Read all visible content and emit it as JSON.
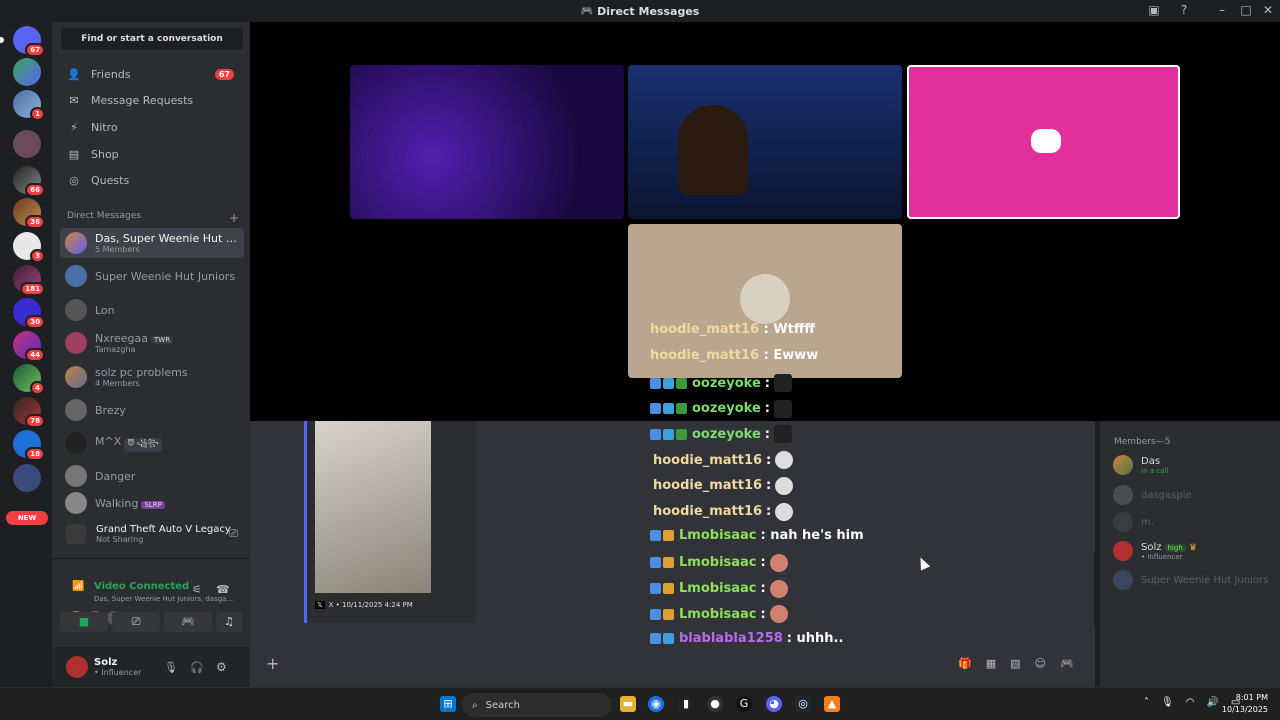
{
  "window": {
    "title": "Direct Messages"
  },
  "servers": {
    "badges": [
      "67",
      "1",
      "66",
      "36",
      "3",
      "181",
      "30",
      "44",
      "4",
      "78",
      "18"
    ],
    "new_label": "NEW"
  },
  "sidebar": {
    "search_placeholder": "Find or start a conversation",
    "nav": [
      {
        "label": "Friends",
        "icon": "friends-icon",
        "count": "67"
      },
      {
        "label": "Message Requests",
        "icon": "mail-icon"
      },
      {
        "label": "Nitro",
        "icon": "nitro-icon"
      },
      {
        "label": "Shop",
        "icon": "shop-icon"
      },
      {
        "label": "Quests",
        "icon": "quests-icon"
      }
    ],
    "dm_header": "Direct Messages",
    "dms": [
      {
        "name": "Das, Super Weenie Hut Juni...",
        "sub": "5 Members",
        "active": true
      },
      {
        "name": "Super Weenie Hut Juniors",
        "sub": ""
      },
      {
        "name": "Lon",
        "sub": ""
      },
      {
        "name": "Nxreegaa",
        "tag": "TWR",
        "sub": "Tamazgha"
      },
      {
        "name": "solz pc problems",
        "sub": "4 Members"
      },
      {
        "name": "Brezy",
        "sub": ""
      },
      {
        "name": "M^X",
        "tag": "😈 ꧁꧂",
        "sub": ""
      },
      {
        "name": "Danger",
        "sub": ""
      },
      {
        "name": "Walking",
        "tag": "SLRP",
        "sub": ""
      }
    ],
    "activity": {
      "game": "Grand Theft Auto V Legacy",
      "status": "Not Sharing"
    },
    "voice": {
      "status": "Video Connected",
      "channel": "Das, Super Weenie Hut Juniors, dasga..."
    },
    "user": {
      "name": "Solz",
      "status": "• Influencer"
    }
  },
  "chat": {
    "overlay_messages": [
      {
        "user": "hoodie_matt16",
        "text": "Wtffff"
      },
      {
        "user": "hoodie_matt16",
        "text": "Ewww"
      }
    ],
    "messages": [
      {
        "user": "oozeyoke",
        "text": ":",
        "kind": "ooze"
      },
      {
        "user": "oozeyoke",
        "text": ":",
        "kind": "ooze"
      },
      {
        "user": "oozeyoke",
        "text": ":",
        "kind": "ooze"
      },
      {
        "user": "hoodie_matt16",
        "text": ":",
        "kind": "hood"
      },
      {
        "user": "hoodie_matt16",
        "text": ":",
        "kind": "hood"
      },
      {
        "user": "hoodie_matt16",
        "text": ":",
        "kind": "hood"
      },
      {
        "user": "Lmobisaac",
        "text": ": nah he's him",
        "kind": "lmo"
      },
      {
        "user": "Lmobisaac",
        "text": ":",
        "kind": "lmo"
      },
      {
        "user": "Lmobisaac",
        "text": ":",
        "kind": "lmo"
      },
      {
        "user": "Lmobisaac",
        "text": ":",
        "kind": "lmo"
      },
      {
        "user": "blablabla1258",
        "text": ": uhhh..",
        "kind": "bla"
      }
    ],
    "embed_footer": "X • 10/11/2025 4:24 PM"
  },
  "members": {
    "header": "Members—5",
    "list": [
      {
        "name": "Das",
        "sub": "In a call",
        "dim": false
      },
      {
        "name": "dasgaspie",
        "sub": "",
        "dim": true
      },
      {
        "name": "m.",
        "sub": "",
        "dim": true
      },
      {
        "name": "Solz",
        "tag": "high",
        "sub": "• Influencer",
        "dim": false
      },
      {
        "name": "Super Weenie Hut Juniors",
        "sub": "",
        "dim": true
      }
    ]
  },
  "taskbar": {
    "search": "Search",
    "time": "8:01 PM",
    "date": "10/13/2025"
  },
  "colors": {
    "accent": "#5865f2",
    "danger": "#f23f43",
    "pink_tile": "#e1309c",
    "online": "#23a55a"
  }
}
